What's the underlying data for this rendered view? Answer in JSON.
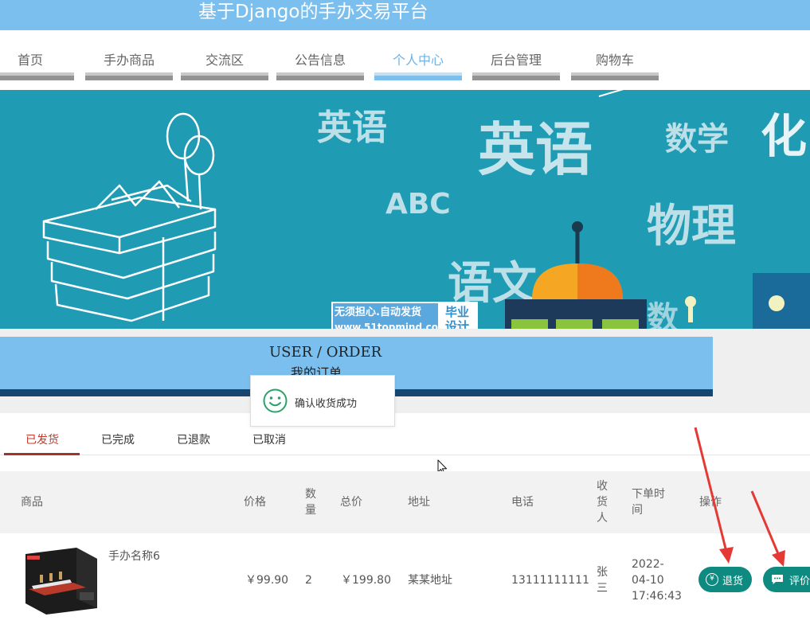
{
  "header": {
    "title": "基于Django的手办交易平台"
  },
  "nav": {
    "items": [
      {
        "label": "首页"
      },
      {
        "label": "手办商品"
      },
      {
        "label": "交流区"
      },
      {
        "label": "公告信息"
      },
      {
        "label": "个人中心"
      },
      {
        "label": "后台管理"
      },
      {
        "label": "购物车"
      }
    ],
    "active_index": 4
  },
  "banner": {
    "words": [
      "英语",
      "英语",
      "数学",
      "化",
      "ABC",
      "物理",
      "语文",
      "数"
    ],
    "watermark": {
      "line1": "无须担心.自动发货",
      "line2": "www.51topmind.com",
      "badge_line1": "毕业",
      "badge_line2": "设计"
    }
  },
  "order_section": {
    "title_en": "USER / ORDER",
    "title_cn": "我的订单"
  },
  "toast": {
    "message": "确认收货成功",
    "icon": "smile-icon"
  },
  "tabs": {
    "items": [
      {
        "label": "已发货"
      },
      {
        "label": "已完成"
      },
      {
        "label": "已退款"
      },
      {
        "label": "已取消"
      }
    ],
    "active_index": 0
  },
  "table": {
    "headers": {
      "product": "商品",
      "price": "价格",
      "qty_1": "数",
      "qty_2": "量",
      "total": "总价",
      "address": "地址",
      "phone": "电话",
      "receiver_1": "收",
      "receiver_2": "货",
      "receiver_3": "人",
      "time_1": "下单时",
      "time_2": "间",
      "action": "操作"
    },
    "rows": [
      {
        "name": "手办名称6",
        "price": "￥99.90",
        "qty": "2",
        "total": "￥199.80",
        "address": "某某地址",
        "phone": "13111111111",
        "receiver_1": "张",
        "receiver_2": "三",
        "time_1": "2022-",
        "time_2": "04-10",
        "time_3": "17:46:43",
        "refund_label": "退货",
        "review_label": "评价"
      }
    ]
  },
  "colors": {
    "header_bg": "#7bbfef",
    "banner_bg": "#1f9bb4",
    "order_box": "#7bbfef",
    "order_border": "#16466f",
    "active_tab": "#c0392b",
    "button": "#0f8a80",
    "arrow": "#e53935"
  }
}
